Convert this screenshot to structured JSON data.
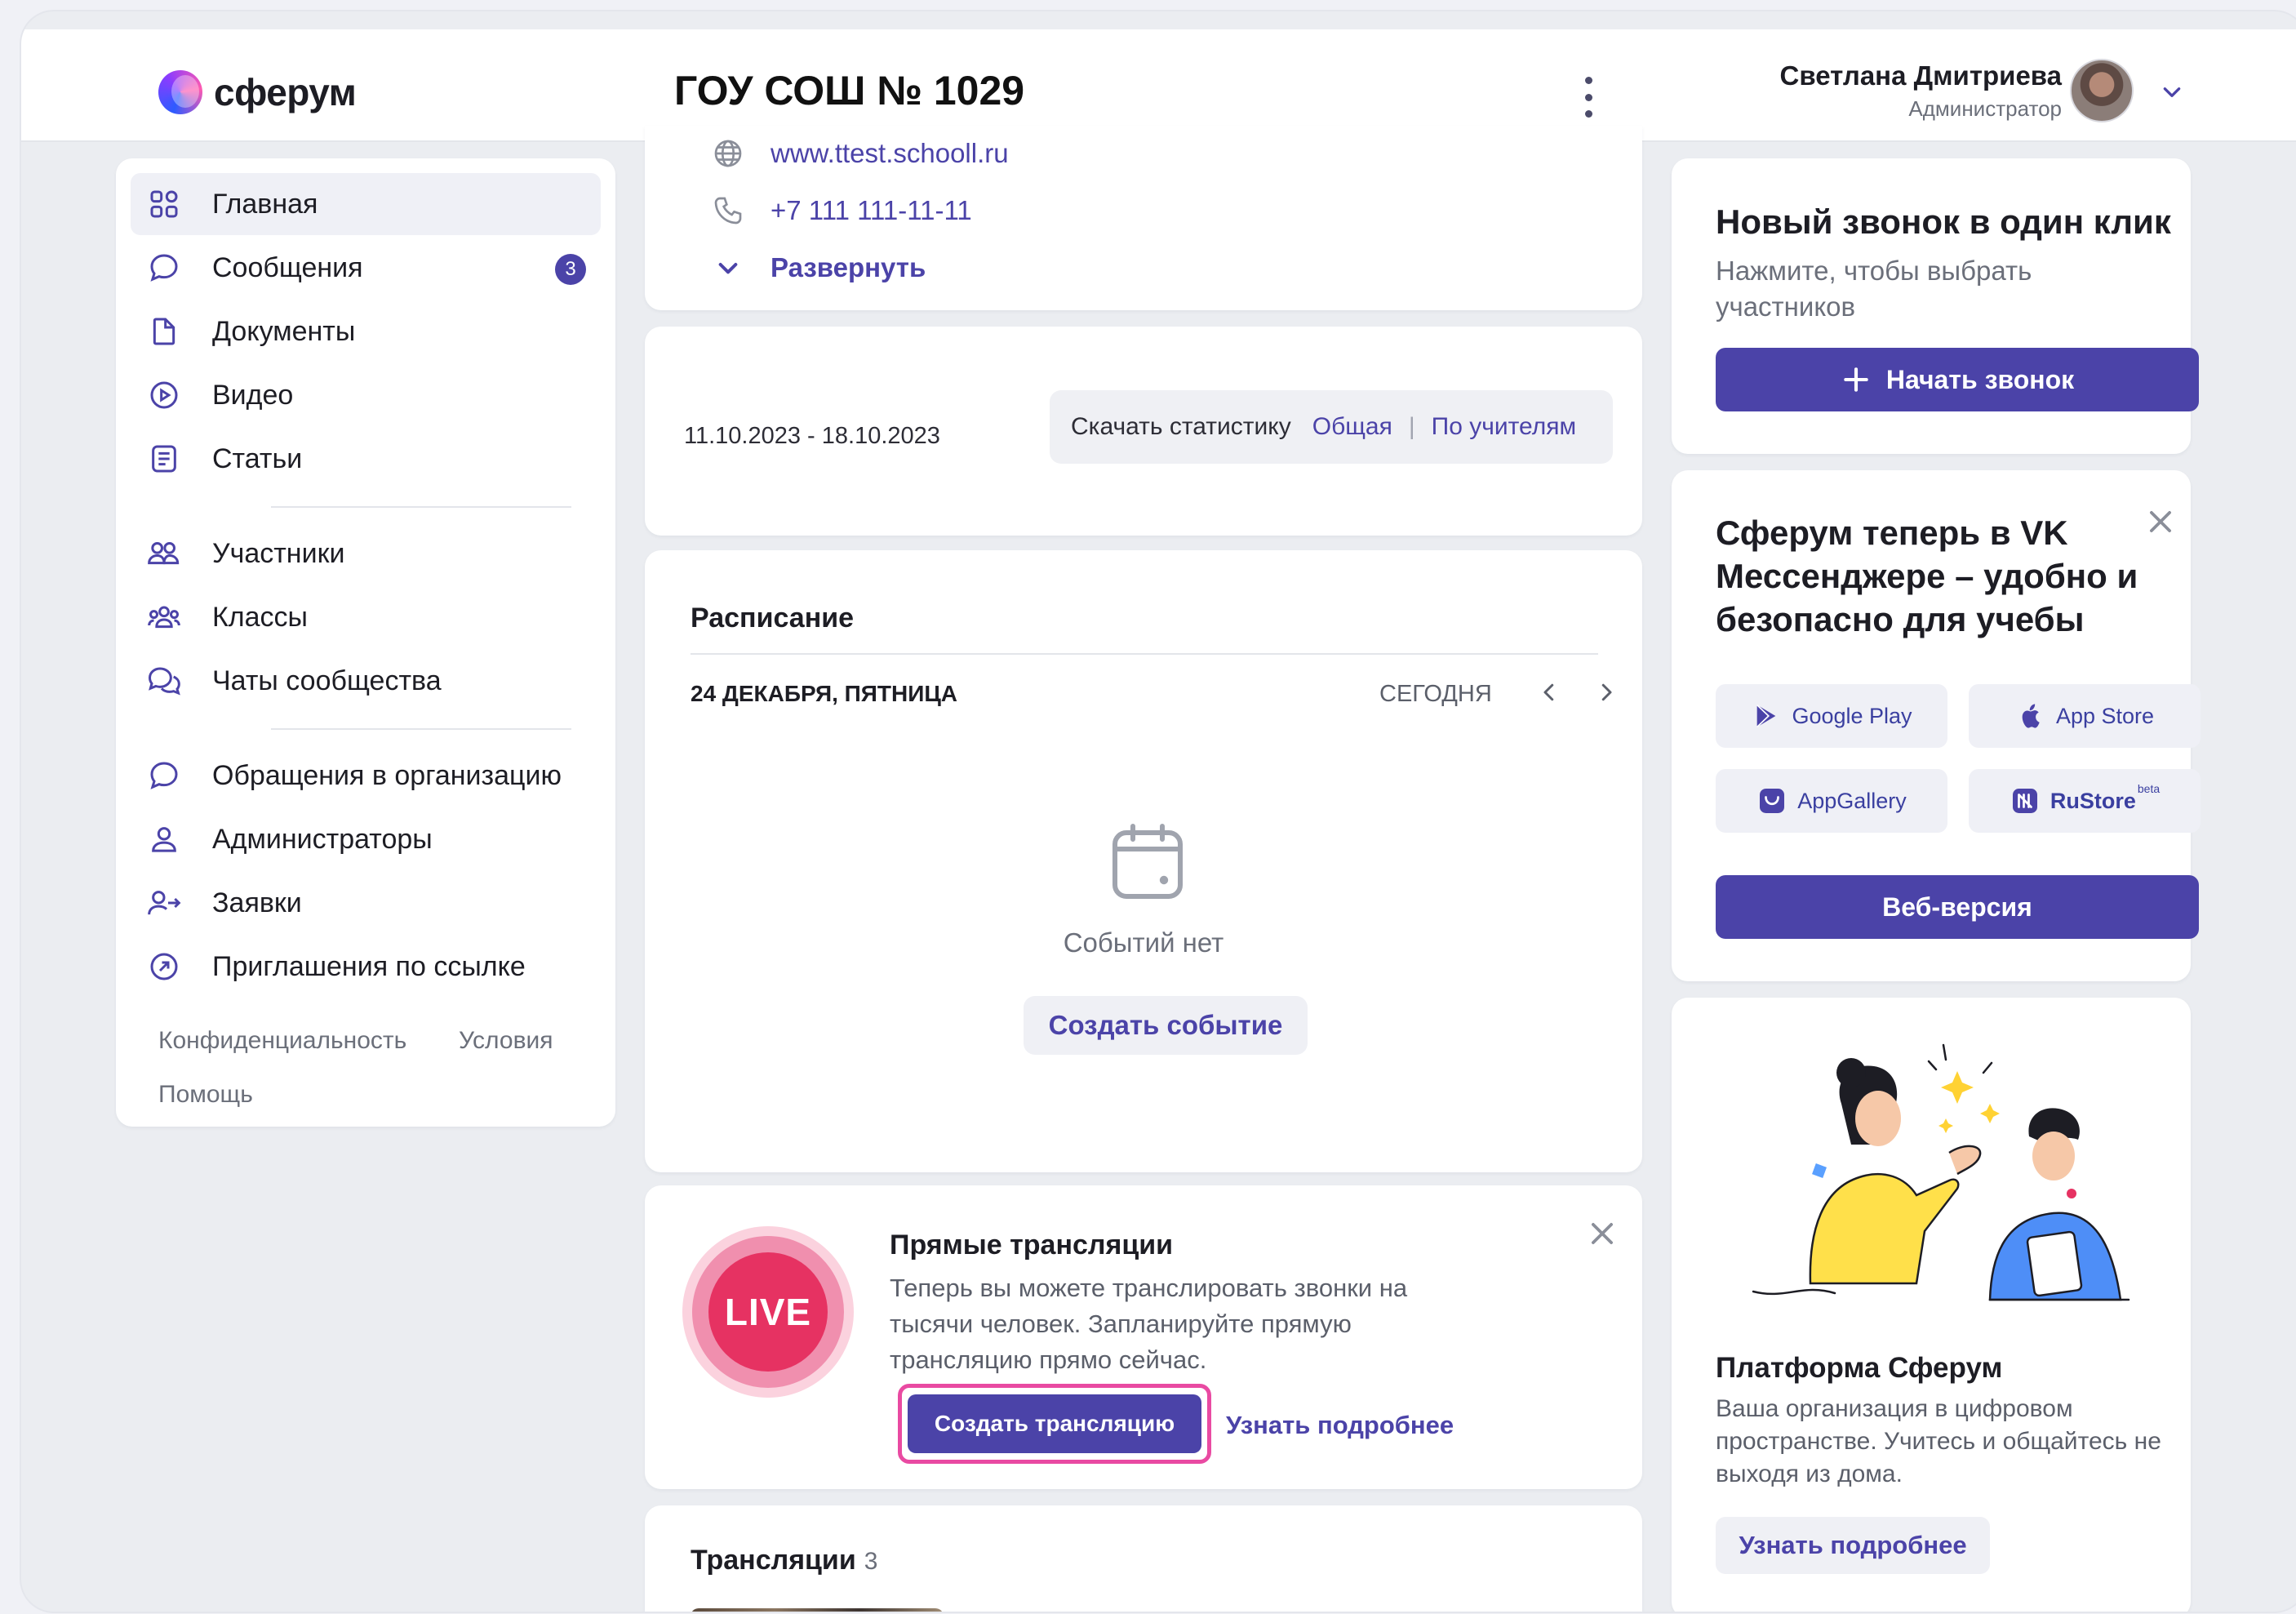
{
  "header": {
    "logo_text": "сферум",
    "org_title": "ГОУ СОШ № 1029",
    "user_name": "Светлана Дмитриева",
    "user_role": "Администратор"
  },
  "sidebar": {
    "items": [
      {
        "label": "Главная",
        "icon": "grid-icon",
        "active": true
      },
      {
        "label": "Сообщения",
        "icon": "chat-bubble-icon",
        "badge": "3"
      },
      {
        "label": "Документы",
        "icon": "document-icon"
      },
      {
        "label": "Видео",
        "icon": "play-circle-icon"
      },
      {
        "label": "Статьи",
        "icon": "article-icon"
      },
      {
        "label": "Участники",
        "icon": "people-icon"
      },
      {
        "label": "Классы",
        "icon": "group-icon"
      },
      {
        "label": "Чаты сообщества",
        "icon": "chats-icon"
      },
      {
        "label": "Обращения в организацию",
        "icon": "chat-bubble-icon"
      },
      {
        "label": "Администраторы",
        "icon": "user-icon"
      },
      {
        "label": "Заявки",
        "icon": "user-arrow-icon"
      },
      {
        "label": "Приглашения по ссылке",
        "icon": "link-arrow-icon"
      }
    ],
    "footer": {
      "privacy": "Конфиденциальность",
      "terms": "Условия",
      "help": "Помощь"
    }
  },
  "info": {
    "website": "www.ttest.schooll.ru",
    "phone": "+7 111 111-11-11",
    "expand": "Развернуть"
  },
  "stats": {
    "date_range": "11.10.2023 - 18.10.2023",
    "download_label": "Скачать статистику",
    "general": "Общая",
    "separator": "|",
    "by_teachers": "По учителям"
  },
  "schedule": {
    "title": "Расписание",
    "date": "24 ДЕКАБРЯ, ПЯТНИЦА",
    "today": "СЕГОДНЯ",
    "empty": "Событий нет",
    "create": "Создать событие"
  },
  "live": {
    "badge": "LIVE",
    "title": "Прямые трансляции",
    "text": "Теперь вы можете транслировать звонки на тысячи человек. Запланируйте прямую трансляцию прямо сейчас.",
    "create": "Создать трансляцию",
    "more": "Узнать подробнее"
  },
  "streams": {
    "title": "Трансляции",
    "count": "3"
  },
  "call": {
    "title": "Новый звонок в один клик",
    "subtitle": "Нажмите, чтобы выбрать участников",
    "button": "Начать звонок"
  },
  "vk": {
    "title": "Сферум теперь в VK Мессенджере – удобно и безопасно для учебы",
    "stores": [
      "Google Play",
      "App Store",
      "AppGallery",
      "RuStore"
    ],
    "rustore_beta": "beta",
    "web": "Веб-версия"
  },
  "platform": {
    "title": "Платформа Сферум",
    "text": "Ваша организация в цифровом пространстве. Учитесь и общайтесь не выходя из дома.",
    "button": "Узнать подробнее"
  },
  "colors": {
    "accent": "#4b43a8",
    "live": "#e63262",
    "highlight": "#e94aa2"
  }
}
